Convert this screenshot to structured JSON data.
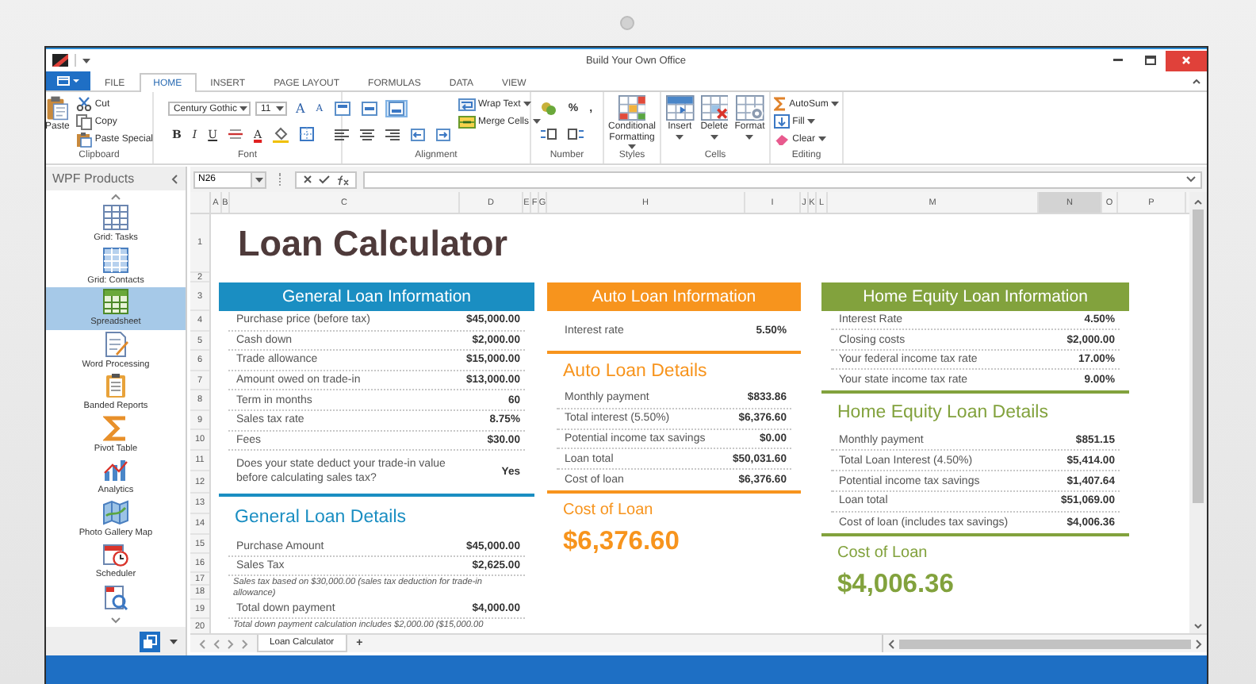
{
  "window": {
    "title": "Build Your Own Office"
  },
  "ribbon_tabs": [
    {
      "label": "FILE",
      "selected": false
    },
    {
      "label": "HOME",
      "selected": true
    },
    {
      "label": "INSERT",
      "selected": false
    },
    {
      "label": "PAGE LAYOUT",
      "selected": false
    },
    {
      "label": "FORMULAS",
      "selected": false
    },
    {
      "label": "DATA",
      "selected": false
    },
    {
      "label": "VIEW",
      "selected": false
    }
  ],
  "ribbon_groups": [
    {
      "label": "Clipboard",
      "items": [
        {
          "kind": "large",
          "label": "Paste"
        },
        {
          "kind": "small",
          "label": "Cut"
        },
        {
          "kind": "small",
          "label": "Copy"
        },
        {
          "kind": "small",
          "label": "Paste Special"
        }
      ]
    },
    {
      "label": "Font",
      "top_controls": [
        {
          "kind": "combo",
          "value": "Century Gothic"
        },
        {
          "kind": "combo",
          "value": "11"
        },
        {
          "kind": "glyph",
          "label": "A"
        },
        {
          "kind": "glyph",
          "label": "A"
        }
      ],
      "bottom_controls": [
        {
          "kind": "glyph",
          "label": "B"
        },
        {
          "kind": "glyph",
          "label": "I"
        },
        {
          "kind": "glyph",
          "label": "U"
        },
        {
          "kind": "icon"
        },
        {
          "kind": "glyph",
          "label": "A"
        },
        {
          "kind": "icon"
        },
        {
          "kind": "icon"
        }
      ]
    },
    {
      "label": "Alignment",
      "top_controls": [
        {
          "kind": "icon",
          "selected": false
        },
        {
          "kind": "icon",
          "selected": false
        },
        {
          "kind": "icon",
          "selected": true
        }
      ],
      "bottom_controls": [
        {
          "kind": "icon"
        },
        {
          "kind": "icon"
        },
        {
          "kind": "icon"
        },
        {
          "kind": "icon"
        },
        {
          "kind": "icon"
        }
      ],
      "items": [
        {
          "kind": "small",
          "label": "Wrap Text"
        },
        {
          "kind": "small",
          "label": "Merge Cells"
        }
      ]
    },
    {
      "label": "Number",
      "top_controls": [
        {
          "kind": "icon"
        },
        {
          "kind": "glyph",
          "label": "%"
        },
        {
          "kind": "glyph",
          "label": ","
        }
      ],
      "bottom_controls": [
        {
          "kind": "icon"
        },
        {
          "kind": "icon"
        }
      ]
    },
    {
      "label": "Styles",
      "items": [
        {
          "kind": "large",
          "label": "Conditional Formatting"
        }
      ]
    },
    {
      "label": "Cells",
      "items": [
        {
          "kind": "large",
          "label": "Insert"
        },
        {
          "kind": "large",
          "label": "Delete"
        },
        {
          "kind": "large",
          "label": "Format"
        }
      ]
    },
    {
      "label": "Editing",
      "items": [
        {
          "kind": "small",
          "label": "AutoSum"
        },
        {
          "kind": "small",
          "label": "Fill"
        },
        {
          "kind": "small",
          "label": "Clear"
        }
      ]
    }
  ],
  "sidebar": {
    "title": "WPF Products",
    "items": [
      {
        "label": "Grid: Tasks",
        "selected": false
      },
      {
        "label": "Grid: Contacts",
        "selected": false
      },
      {
        "label": "Spreadsheet",
        "selected": true
      },
      {
        "label": "Word Processing",
        "selected": false
      },
      {
        "label": "Banded Reports",
        "selected": false
      },
      {
        "label": "Pivot Table",
        "selected": false
      },
      {
        "label": "Analytics",
        "selected": false
      },
      {
        "label": "Photo Gallery Map",
        "selected": false
      },
      {
        "label": "Scheduler",
        "selected": false
      }
    ]
  },
  "formula_bar": {
    "name_box": "N26"
  },
  "sheet": {
    "columns": [
      {
        "label": "A",
        "selected": false
      },
      {
        "label": "B",
        "selected": false
      },
      {
        "label": "C",
        "selected": false
      },
      {
        "label": "D",
        "selected": false
      },
      {
        "label": "E",
        "selected": false
      },
      {
        "label": "F",
        "selected": false
      },
      {
        "label": "G",
        "selected": false
      },
      {
        "label": "H",
        "selected": false
      },
      {
        "label": "I",
        "selected": false
      },
      {
        "label": "J",
        "selected": false
      },
      {
        "label": "K",
        "selected": false
      },
      {
        "label": "L",
        "selected": false
      },
      {
        "label": "M",
        "selected": false
      },
      {
        "label": "N",
        "selected": true
      },
      {
        "label": "O",
        "selected": false
      },
      {
        "label": "P",
        "selected": false
      }
    ],
    "rows": [
      "1",
      "2",
      "3",
      "4",
      "5",
      "6",
      "7",
      "8",
      "9",
      "10",
      "11",
      "12",
      "13",
      "14",
      "15",
      "16",
      "17",
      "18",
      "19",
      "20"
    ],
    "title": "Loan Calculator",
    "panels": [
      {
        "color": "#1a8ec2",
        "header": "General Loan Information",
        "info_rows": [
          {
            "kind": "row",
            "label": "Purchase price (before tax)",
            "value": "$45,000.00"
          },
          {
            "kind": "row",
            "label": "Cash down",
            "value": "$2,000.00"
          },
          {
            "kind": "row",
            "label": "Trade allowance",
            "value": "$15,000.00"
          },
          {
            "kind": "row",
            "label": "Amount owed on trade-in",
            "value": "$13,000.00"
          },
          {
            "kind": "row",
            "label": "Term in months",
            "value": "60"
          },
          {
            "kind": "row",
            "label": "Sales tax rate",
            "value": "8.75%"
          },
          {
            "kind": "row",
            "label": "Fees",
            "value": "$30.00"
          },
          {
            "kind": "question",
            "label": "Does your state deduct your trade-in value before calculating sales tax?",
            "value": "Yes"
          }
        ],
        "details_title": "General Loan Details",
        "detail_rows": [
          {
            "kind": "row",
            "label": "Purchase Amount",
            "value": "$45,000.00"
          },
          {
            "kind": "row",
            "label": "Sales Tax",
            "value": "$2,625.00"
          },
          {
            "kind": "note",
            "label": "Sales tax based on $30,000.00 (sales tax deduction for trade-in allowance)"
          },
          {
            "kind": "row",
            "label": "Total down payment",
            "value": "$4,000.00"
          },
          {
            "kind": "note",
            "label": "Total down payment calculation includes $2,000.00 ($15,000.00"
          }
        ]
      },
      {
        "color": "#f7941d",
        "header": "Auto Loan Information",
        "info_rows": [
          {
            "kind": "row",
            "label": "Interest rate",
            "value": "5.50%"
          }
        ],
        "details_title": "Auto Loan Details",
        "detail_rows": [
          {
            "kind": "row",
            "label": "Monthly payment",
            "value": "$833.86"
          },
          {
            "kind": "row",
            "label": "Total interest (5.50%)",
            "value": "$6,376.60"
          },
          {
            "kind": "row",
            "label": "Potential income tax savings",
            "value": "$0.00"
          },
          {
            "kind": "row",
            "label": "Loan total",
            "value": "$50,031.60"
          },
          {
            "kind": "row",
            "label": "Cost of loan",
            "value": "$6,376.60"
          }
        ],
        "cost_title": "Cost of Loan",
        "cost_amount": "$6,376.60"
      },
      {
        "color": "#82a23d",
        "header": "Home Equity Loan Information",
        "info_rows": [
          {
            "kind": "row",
            "label": "Interest Rate",
            "value": "4.50%"
          },
          {
            "kind": "row",
            "label": "Closing costs",
            "value": "$2,000.00"
          },
          {
            "kind": "row",
            "label": "Your federal income tax rate",
            "value": "17.00%"
          },
          {
            "kind": "row",
            "label": "Your state income tax rate",
            "value": "9.00%"
          }
        ],
        "details_title": "Home Equity Loan Details",
        "detail_rows": [
          {
            "kind": "row",
            "label": "Monthly payment",
            "value": "$851.15"
          },
          {
            "kind": "row",
            "label": "Total Loan Interest (4.50%)",
            "value": "$5,414.00"
          },
          {
            "kind": "row",
            "label": "Potential income tax savings",
            "value": "$1,407.64"
          },
          {
            "kind": "row",
            "label": "Loan total",
            "value": "$51,069.00"
          },
          {
            "kind": "row",
            "label": "Cost of loan (includes tax savings)",
            "value": "$4,006.36"
          }
        ],
        "cost_title": "Cost of Loan",
        "cost_amount": "$4,006.36"
      }
    ]
  },
  "sheet_tabs": {
    "tabs": [
      {
        "label": "Loan Calculator",
        "selected": true
      }
    ],
    "add": "+"
  }
}
